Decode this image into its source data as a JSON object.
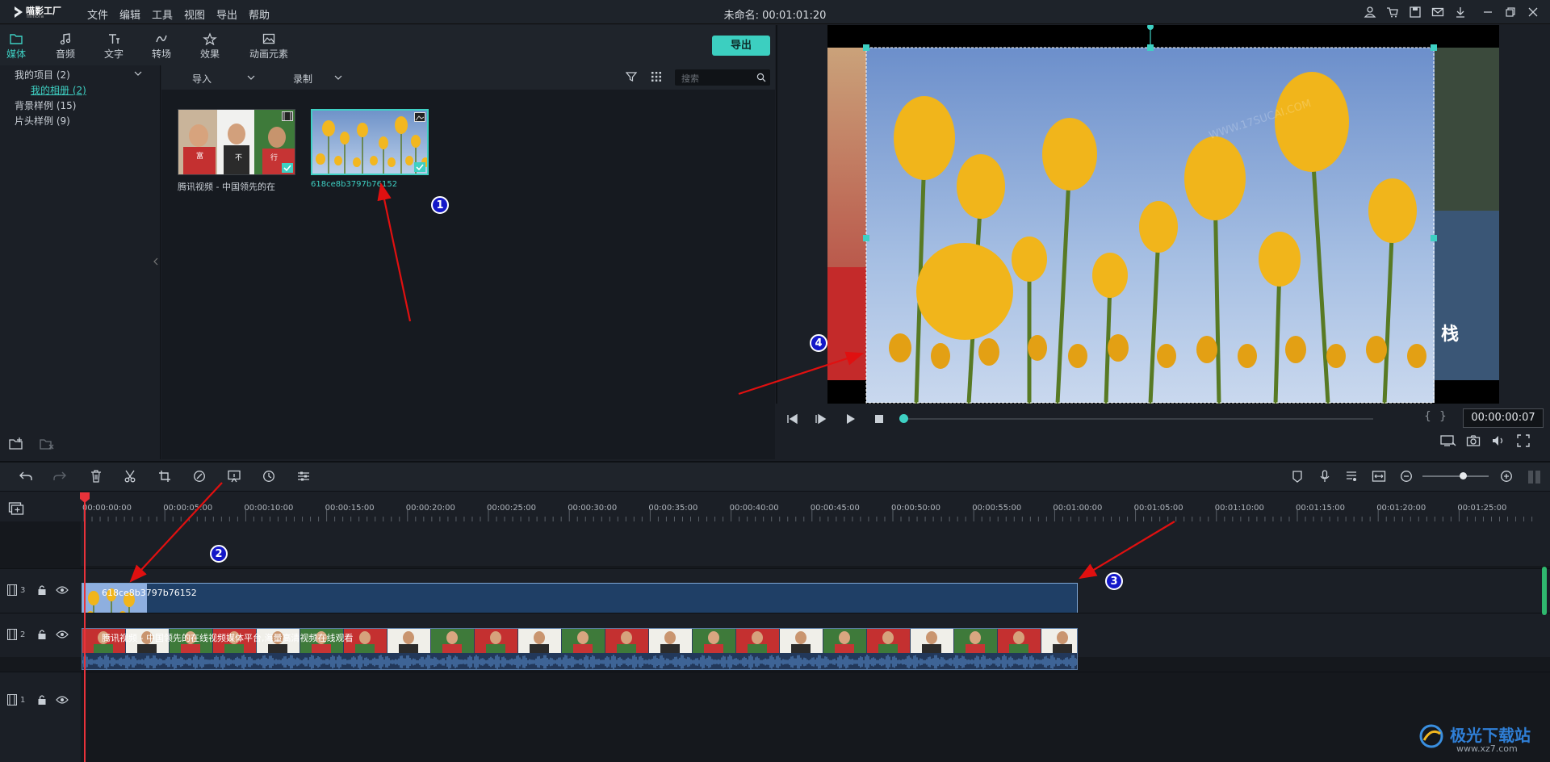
{
  "app": {
    "logo_text": "喵影工厂",
    "logo_sub": "filmora",
    "doc_title": "未命名: 00:01:01:20"
  },
  "menu": [
    "文件",
    "编辑",
    "工具",
    "视图",
    "导出",
    "帮助"
  ],
  "tabs": [
    {
      "label": "媒体",
      "icon": "folder-icon"
    },
    {
      "label": "音频",
      "icon": "music-note-icon"
    },
    {
      "label": "文字",
      "icon": "text-icon"
    },
    {
      "label": "转场",
      "icon": "transition-icon"
    },
    {
      "label": "效果",
      "icon": "effects-icon"
    },
    {
      "label": "动画元素",
      "icon": "image-icon"
    }
  ],
  "export_label": "导出",
  "tree": {
    "items": [
      "我的项目 (2)",
      "我的相册 (2)",
      "背景样例 (15)",
      "片头样例 (9)"
    ]
  },
  "media_toolbar": {
    "import_label": "导入",
    "record_label": "录制",
    "search_placeholder": "搜索"
  },
  "media_items": [
    {
      "label": "腾讯视频 - 中国领先的在",
      "type": "video",
      "checked": true
    },
    {
      "label": "618ce8b3797b76152",
      "type": "image",
      "checked": true,
      "selected": true
    }
  ],
  "preview": {
    "timecode": "00:00:00:07",
    "watermark": "WWW.17SUCAI.COM",
    "bracket_in": "{",
    "bracket_out": "}"
  },
  "ruler": [
    "00:00:00:00",
    "00:00:05:00",
    "00:00:10:00",
    "00:00:15:00",
    "00:00:20:00",
    "00:00:25:00",
    "00:00:30:00",
    "00:00:35:00",
    "00:00:40:00",
    "00:00:45:00",
    "00:00:50:00",
    "00:00:55:00",
    "00:01:00:00",
    "00:01:05:00",
    "00:01:10:00",
    "00:01:15:00",
    "00:01:20:00",
    "00:01:25:00"
  ],
  "tracks": [
    {
      "num": "3"
    },
    {
      "num": "2"
    },
    {
      "num": "1"
    }
  ],
  "clips": {
    "image_clip": "618ce8b3797b76152",
    "video_clip": "腾讯视频 - 中国领先的在线视频媒体平台,海量高清视频在线观看"
  },
  "callouts": [
    "1",
    "2",
    "3",
    "4"
  ],
  "watermark_site": {
    "name": "极光下载站",
    "url": "www.xz7.com"
  },
  "colors": {
    "accent": "#3ed0c3",
    "playhead": "#e8323a",
    "clip_image": "#1f3f66",
    "clip_video": "#2a3e5e",
    "callout": "#1418c8",
    "arrow": "#e01010"
  }
}
